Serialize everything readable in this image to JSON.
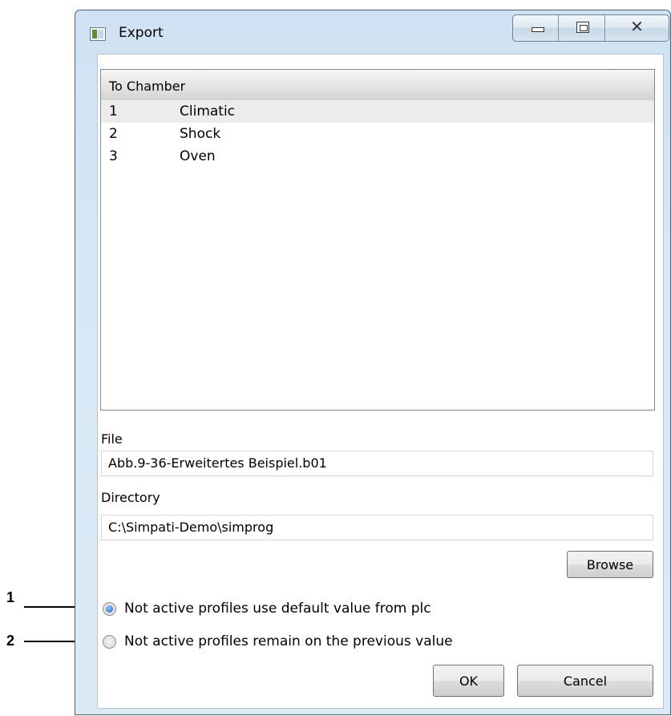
{
  "callouts": [
    "1",
    "2"
  ],
  "window": {
    "title": "Export",
    "icon": "app-window-icon",
    "close_glyph": "✕"
  },
  "list": {
    "header": "To Chamber",
    "rows": [
      {
        "num": "1",
        "name": "Climatic"
      },
      {
        "num": "2",
        "name": "Shock"
      },
      {
        "num": "3",
        "name": "Oven"
      }
    ],
    "selected_index": 0
  },
  "file": {
    "label": "File",
    "value": "Abb.9-36-Erweitertes Beispiel.b01"
  },
  "directory": {
    "label": "Directory",
    "value": "C:\\Simpati-Demo\\simprog"
  },
  "buttons": {
    "browse": "Browse",
    "ok": "OK",
    "cancel": "Cancel"
  },
  "options": {
    "selected": 0,
    "items": [
      "Not active profiles use default value from plc",
      "Not active profiles remain on the previous value"
    ]
  },
  "colors": {
    "frame": "#d7e8f5",
    "selection": "#ececec",
    "radio_dot": "#1f63b8"
  }
}
